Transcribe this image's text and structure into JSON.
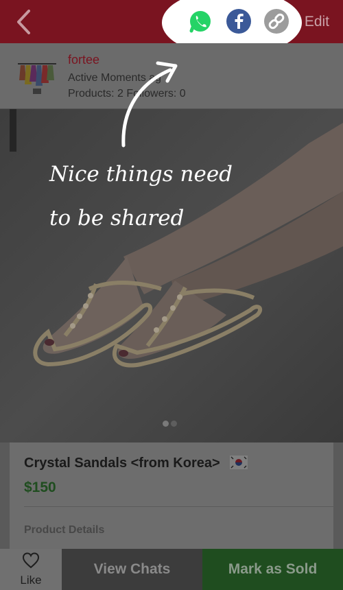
{
  "header": {
    "edit_label": "Edit",
    "share_icons": [
      "whatsapp-icon",
      "facebook-icon",
      "link-icon"
    ]
  },
  "shop": {
    "name": "fortee",
    "status": "Active Moments ag",
    "stats": "Products: 2   Followers: 0"
  },
  "annotation": {
    "line1": "Nice things need",
    "line2": "to be shared"
  },
  "product": {
    "title": "Crystal Sandals <from Korea>",
    "price": "$150",
    "details_label": "Product Details",
    "image_count": 2,
    "current_image": 1
  },
  "actions": {
    "like_label": "Like",
    "chats_label": "View Chats",
    "sold_label": "Mark as Sold"
  },
  "colors": {
    "header_bg": "#7a1420",
    "accent_red": "#7a1420",
    "price_green": "#1f4d1f",
    "sold_bg": "#1f4d1f",
    "chats_bg": "#3c3c3c",
    "whatsapp": "#25d366",
    "facebook": "#3b5998"
  }
}
